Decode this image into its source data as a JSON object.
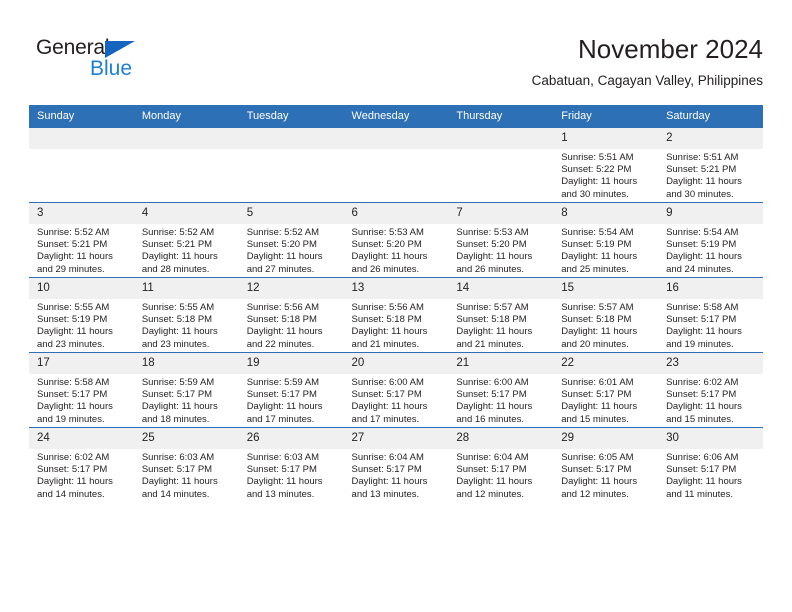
{
  "brand": {
    "name_dark": "General",
    "name_blue": "Blue",
    "accent_blue": "#1f7fd4",
    "triangle_blue": "#1565c0"
  },
  "header": {
    "title": "November 2024",
    "subtitle": "Cabatuan, Cagayan Valley, Philippines"
  },
  "colors": {
    "header_row": "#2e70b5",
    "day_band": "#f0f0f0",
    "text": "#231f20"
  },
  "calendar": {
    "weekday_headers": [
      "Sunday",
      "Monday",
      "Tuesday",
      "Wednesday",
      "Thursday",
      "Friday",
      "Saturday"
    ],
    "weeks": [
      [
        {
          "day": "",
          "empty": true
        },
        {
          "day": "",
          "empty": true
        },
        {
          "day": "",
          "empty": true
        },
        {
          "day": "",
          "empty": true
        },
        {
          "day": "",
          "empty": true
        },
        {
          "day": "1",
          "sunrise": "Sunrise: 5:51 AM",
          "sunset": "Sunset: 5:22 PM",
          "daylight": "Daylight: 11 hours and 30 minutes."
        },
        {
          "day": "2",
          "sunrise": "Sunrise: 5:51 AM",
          "sunset": "Sunset: 5:21 PM",
          "daylight": "Daylight: 11 hours and 30 minutes."
        }
      ],
      [
        {
          "day": "3",
          "sunrise": "Sunrise: 5:52 AM",
          "sunset": "Sunset: 5:21 PM",
          "daylight": "Daylight: 11 hours and 29 minutes."
        },
        {
          "day": "4",
          "sunrise": "Sunrise: 5:52 AM",
          "sunset": "Sunset: 5:21 PM",
          "daylight": "Daylight: 11 hours and 28 minutes."
        },
        {
          "day": "5",
          "sunrise": "Sunrise: 5:52 AM",
          "sunset": "Sunset: 5:20 PM",
          "daylight": "Daylight: 11 hours and 27 minutes."
        },
        {
          "day": "6",
          "sunrise": "Sunrise: 5:53 AM",
          "sunset": "Sunset: 5:20 PM",
          "daylight": "Daylight: 11 hours and 26 minutes."
        },
        {
          "day": "7",
          "sunrise": "Sunrise: 5:53 AM",
          "sunset": "Sunset: 5:20 PM",
          "daylight": "Daylight: 11 hours and 26 minutes."
        },
        {
          "day": "8",
          "sunrise": "Sunrise: 5:54 AM",
          "sunset": "Sunset: 5:19 PM",
          "daylight": "Daylight: 11 hours and 25 minutes."
        },
        {
          "day": "9",
          "sunrise": "Sunrise: 5:54 AM",
          "sunset": "Sunset: 5:19 PM",
          "daylight": "Daylight: 11 hours and 24 minutes."
        }
      ],
      [
        {
          "day": "10",
          "sunrise": "Sunrise: 5:55 AM",
          "sunset": "Sunset: 5:19 PM",
          "daylight": "Daylight: 11 hours and 23 minutes."
        },
        {
          "day": "11",
          "sunrise": "Sunrise: 5:55 AM",
          "sunset": "Sunset: 5:18 PM",
          "daylight": "Daylight: 11 hours and 23 minutes."
        },
        {
          "day": "12",
          "sunrise": "Sunrise: 5:56 AM",
          "sunset": "Sunset: 5:18 PM",
          "daylight": "Daylight: 11 hours and 22 minutes."
        },
        {
          "day": "13",
          "sunrise": "Sunrise: 5:56 AM",
          "sunset": "Sunset: 5:18 PM",
          "daylight": "Daylight: 11 hours and 21 minutes."
        },
        {
          "day": "14",
          "sunrise": "Sunrise: 5:57 AM",
          "sunset": "Sunset: 5:18 PM",
          "daylight": "Daylight: 11 hours and 21 minutes."
        },
        {
          "day": "15",
          "sunrise": "Sunrise: 5:57 AM",
          "sunset": "Sunset: 5:18 PM",
          "daylight": "Daylight: 11 hours and 20 minutes."
        },
        {
          "day": "16",
          "sunrise": "Sunrise: 5:58 AM",
          "sunset": "Sunset: 5:17 PM",
          "daylight": "Daylight: 11 hours and 19 minutes."
        }
      ],
      [
        {
          "day": "17",
          "sunrise": "Sunrise: 5:58 AM",
          "sunset": "Sunset: 5:17 PM",
          "daylight": "Daylight: 11 hours and 19 minutes."
        },
        {
          "day": "18",
          "sunrise": "Sunrise: 5:59 AM",
          "sunset": "Sunset: 5:17 PM",
          "daylight": "Daylight: 11 hours and 18 minutes."
        },
        {
          "day": "19",
          "sunrise": "Sunrise: 5:59 AM",
          "sunset": "Sunset: 5:17 PM",
          "daylight": "Daylight: 11 hours and 17 minutes."
        },
        {
          "day": "20",
          "sunrise": "Sunrise: 6:00 AM",
          "sunset": "Sunset: 5:17 PM",
          "daylight": "Daylight: 11 hours and 17 minutes."
        },
        {
          "day": "21",
          "sunrise": "Sunrise: 6:00 AM",
          "sunset": "Sunset: 5:17 PM",
          "daylight": "Daylight: 11 hours and 16 minutes."
        },
        {
          "day": "22",
          "sunrise": "Sunrise: 6:01 AM",
          "sunset": "Sunset: 5:17 PM",
          "daylight": "Daylight: 11 hours and 15 minutes."
        },
        {
          "day": "23",
          "sunrise": "Sunrise: 6:02 AM",
          "sunset": "Sunset: 5:17 PM",
          "daylight": "Daylight: 11 hours and 15 minutes."
        }
      ],
      [
        {
          "day": "24",
          "sunrise": "Sunrise: 6:02 AM",
          "sunset": "Sunset: 5:17 PM",
          "daylight": "Daylight: 11 hours and 14 minutes."
        },
        {
          "day": "25",
          "sunrise": "Sunrise: 6:03 AM",
          "sunset": "Sunset: 5:17 PM",
          "daylight": "Daylight: 11 hours and 14 minutes."
        },
        {
          "day": "26",
          "sunrise": "Sunrise: 6:03 AM",
          "sunset": "Sunset: 5:17 PM",
          "daylight": "Daylight: 11 hours and 13 minutes."
        },
        {
          "day": "27",
          "sunrise": "Sunrise: 6:04 AM",
          "sunset": "Sunset: 5:17 PM",
          "daylight": "Daylight: 11 hours and 13 minutes."
        },
        {
          "day": "28",
          "sunrise": "Sunrise: 6:04 AM",
          "sunset": "Sunset: 5:17 PM",
          "daylight": "Daylight: 11 hours and 12 minutes."
        },
        {
          "day": "29",
          "sunrise": "Sunrise: 6:05 AM",
          "sunset": "Sunset: 5:17 PM",
          "daylight": "Daylight: 11 hours and 12 minutes."
        },
        {
          "day": "30",
          "sunrise": "Sunrise: 6:06 AM",
          "sunset": "Sunset: 5:17 PM",
          "daylight": "Daylight: 11 hours and 11 minutes."
        }
      ]
    ]
  }
}
